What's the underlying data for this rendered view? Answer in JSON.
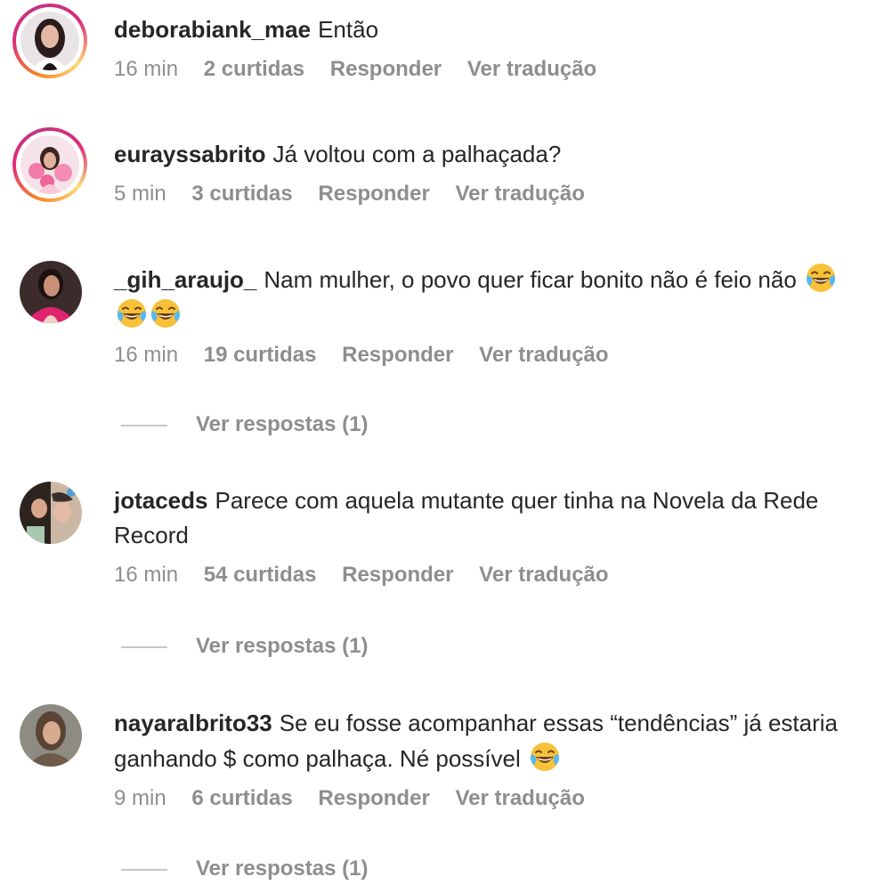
{
  "comments": [
    {
      "username": "deborabiank_mae",
      "text": "Então",
      "time": "16 min",
      "likes": "2 curtidas",
      "reply": "Responder",
      "translate": "Ver tradução",
      "story_ring": true
    },
    {
      "username": "eurayssabrito",
      "text": "Já voltou com a palhaçada?",
      "time": "5 min",
      "likes": "3 curtidas",
      "reply": "Responder",
      "translate": "Ver tradução",
      "story_ring": true
    },
    {
      "username": "_gih_araujo_",
      "text": "Nam mulher, o povo quer ficar bonito não é feio não",
      "emoji": [
        "face-with-tears-of-joy",
        "face-with-tears-of-joy",
        "face-with-tears-of-joy"
      ],
      "time": "16 min",
      "likes": "19 curtidas",
      "reply": "Responder",
      "translate": "Ver tradução",
      "view_replies": "Ver respostas (1)"
    },
    {
      "username": "jotaceds",
      "text": "Parece com aquela mutante quer tinha na Novela da Rede Record",
      "time": "16 min",
      "likes": "54 curtidas",
      "reply": "Responder",
      "translate": "Ver tradução",
      "view_replies": "Ver respostas (1)"
    },
    {
      "username": "nayaralbrito33",
      "text": "Se eu fosse acompanhar essas “tendências” já estaria ganhando $ como palhaça. Né possível",
      "emoji": [
        "face-with-tears-of-joy"
      ],
      "time": "9 min",
      "likes": "6 curtidas",
      "reply": "Responder",
      "translate": "Ver tradução",
      "view_replies": "Ver respostas (1)"
    }
  ],
  "colors": {
    "text": "#262626",
    "secondary": "#8e8e8e",
    "divider": "#c7c7c7",
    "ring_start": "#f58529",
    "ring_end": "#c13584"
  }
}
